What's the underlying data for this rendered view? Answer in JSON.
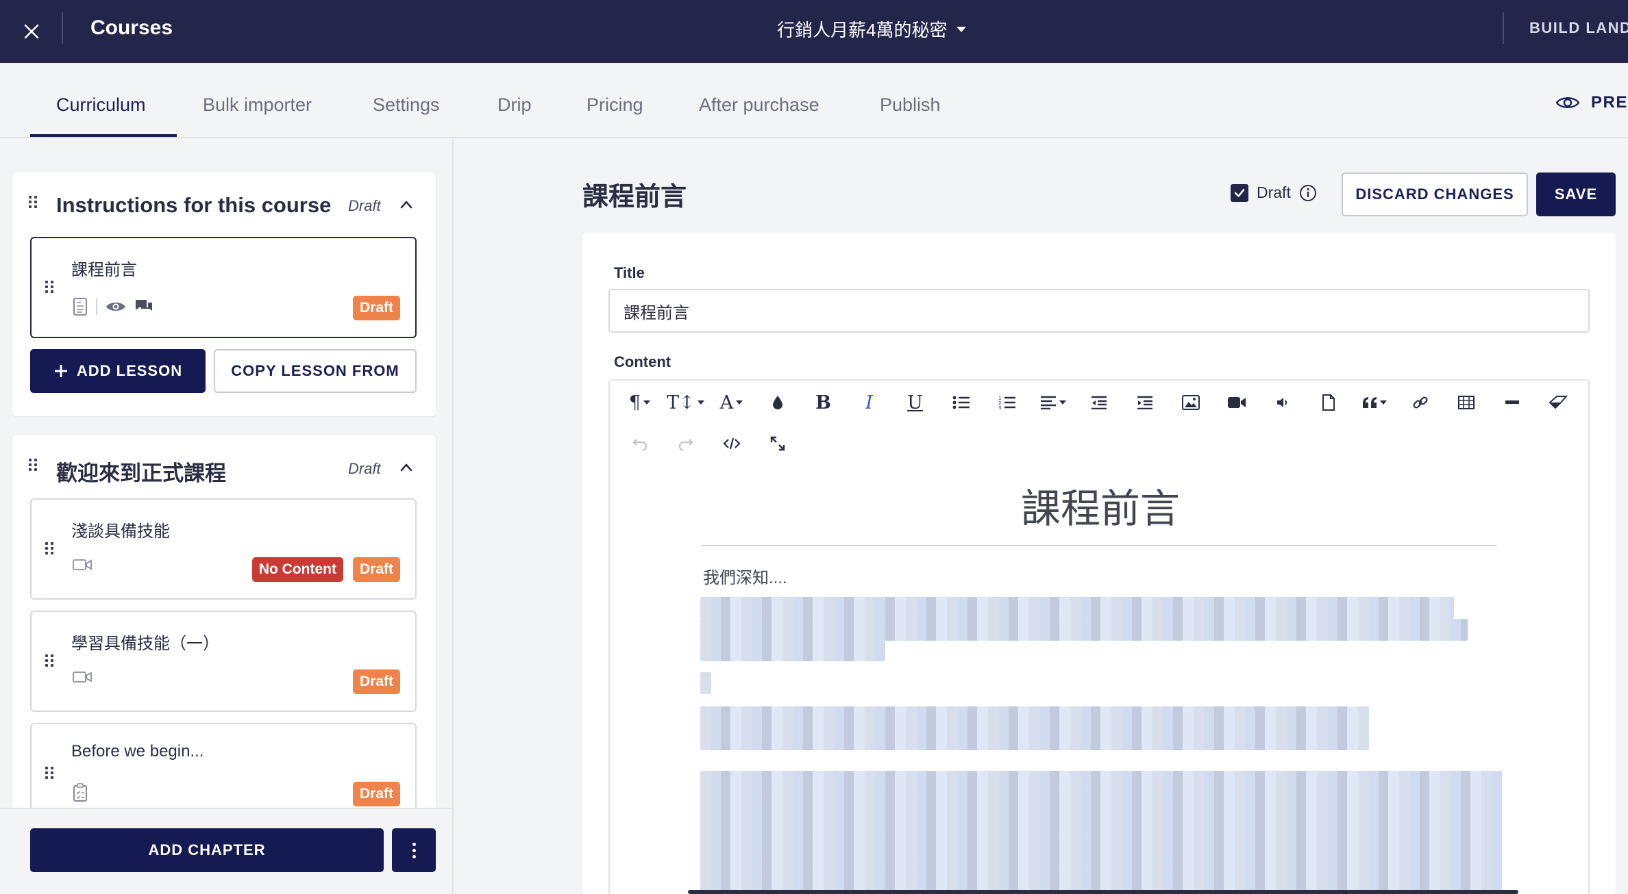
{
  "topbar": {
    "title": "Courses",
    "course_name": "行銷人月薪4萬的秘密",
    "build_landing": "BUILD LANDI"
  },
  "tabs": [
    {
      "label": "Curriculum",
      "active": true
    },
    {
      "label": "Bulk importer"
    },
    {
      "label": "Settings"
    },
    {
      "label": "Drip"
    },
    {
      "label": "Pricing"
    },
    {
      "label": "After purchase"
    },
    {
      "label": "Publish"
    }
  ],
  "preview_label": "PREV",
  "chapters": [
    {
      "title": "Instructions for this course",
      "status": "Draft",
      "lessons": [
        {
          "title": "課程前言",
          "badges": [
            "Draft"
          ]
        }
      ],
      "add_lesson": "ADD LESSON",
      "copy_lesson": "COPY LESSON FROM"
    },
    {
      "title": "歡迎來到正式課程",
      "status": "Draft",
      "lessons": [
        {
          "title": "淺談具備技能",
          "badges": [
            "No Content",
            "Draft"
          ]
        },
        {
          "title": "學習具備技能（一）",
          "badges": [
            "Draft"
          ]
        },
        {
          "title": "Before we begin...",
          "badges": [
            "Draft"
          ]
        }
      ]
    }
  ],
  "footer": {
    "add_chapter": "ADD CHAPTER"
  },
  "editor": {
    "heading": "課程前言",
    "draft_label": "Draft",
    "draft_checked": true,
    "discard": "DISCARD CHANGES",
    "save": "SAVE",
    "title_label": "Title",
    "title_value": "課程前言",
    "content_label": "Content",
    "doc_heading": "課程前言",
    "doc_intro": "我們深知...."
  },
  "colors": {
    "topbar": "#23254a",
    "primary": "#161a52",
    "draft_badge": "#f0834a",
    "no_content_badge": "#cb3b36"
  }
}
